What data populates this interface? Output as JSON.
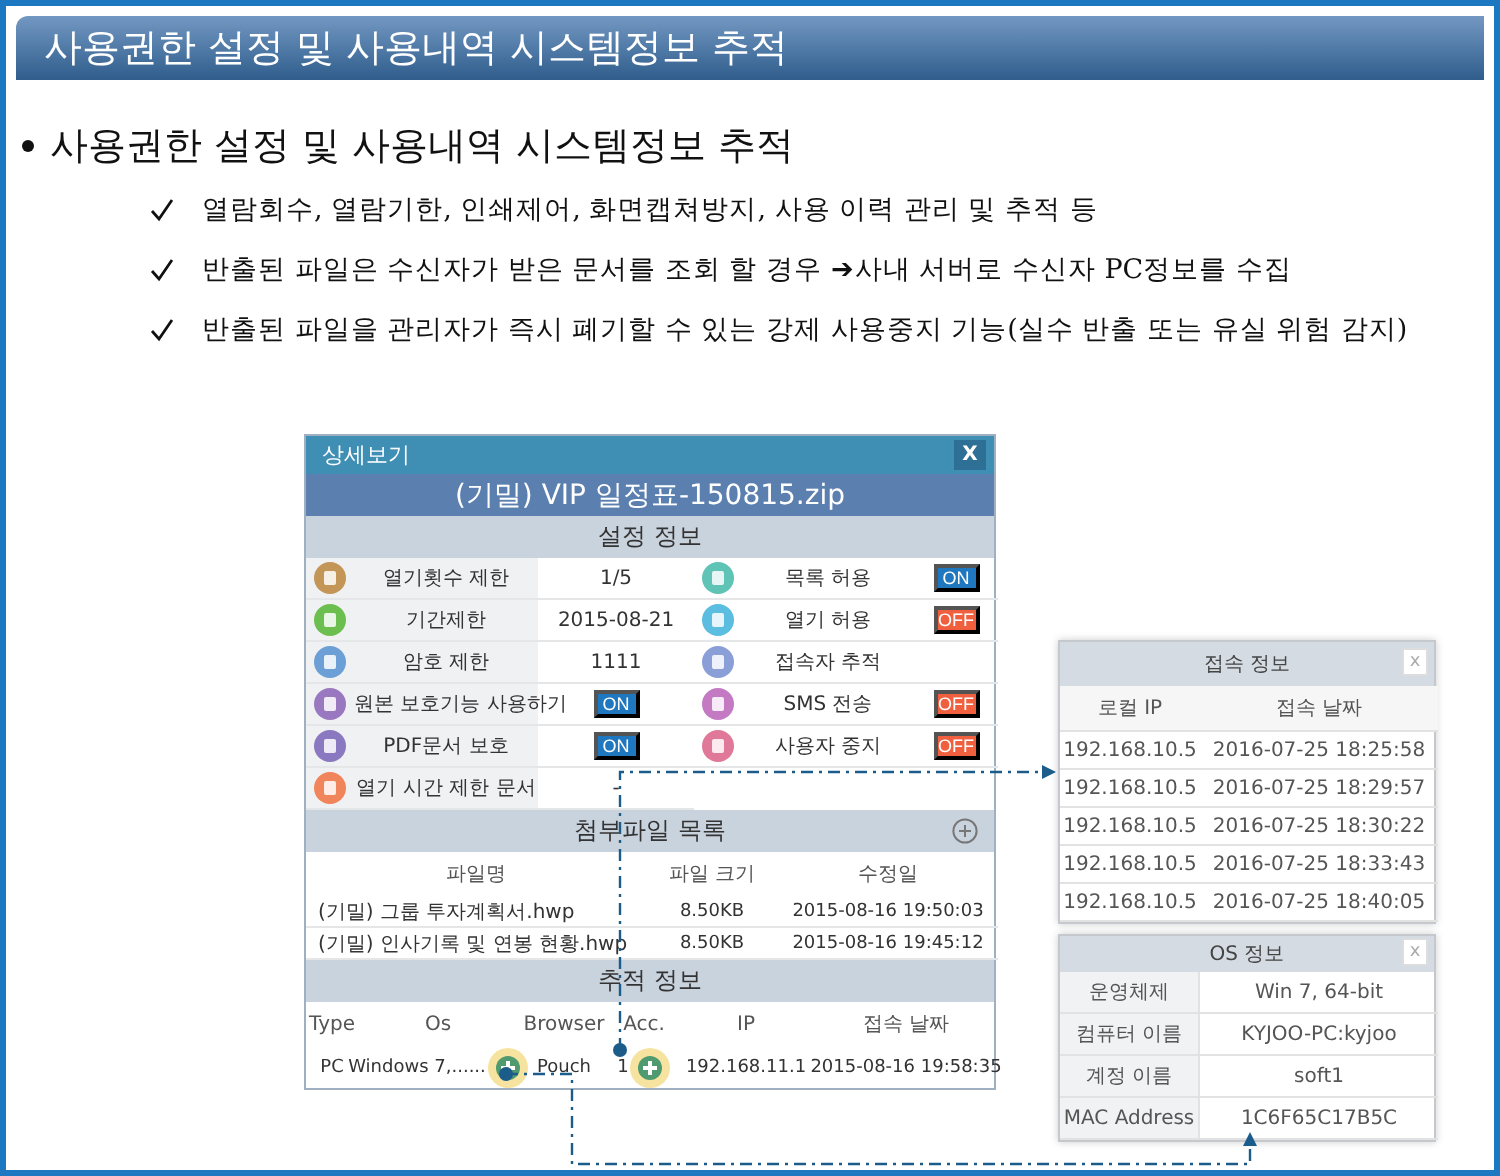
{
  "slide_title": "사용권한 설정 및 사용내역 시스템정보 추적",
  "heading": "사용권한 설정 및 사용내역 시스템정보 추적",
  "bullets": [
    "열람회수, 열람기한, 인쇄제어, 화면캡쳐방지, 사용 이력 관리 및 추적 등",
    "반출된 파일은 수신자가 받은 문서를 조회 할 경우 ➔사내 서버로 수신자 PC정보를 수집",
    "반출된 파일을 관리자가 즉시 폐기할 수 있는 강제 사용중지 기능(실수 반출 또는 유실 위험 감지)"
  ],
  "detail_window": {
    "title": "상세보기",
    "close": "X",
    "file_name": "(기밀) VIP 일정표-150815.zip",
    "settings_header": "설정 정보",
    "settings": [
      {
        "kind": "text",
        "label": "열기횟수 제한",
        "color": "#c39556",
        "value": "1/5"
      },
      {
        "kind": "switch",
        "label": "목록 허용",
        "color": "#5fc3b5",
        "value": "ON",
        "on": true
      },
      {
        "kind": "text",
        "label": "기간제한",
        "color": "#6cbf4f",
        "value": "2015-08-21"
      },
      {
        "kind": "switch",
        "label": "열기 허용",
        "color": "#5bbde0",
        "value": "OFF",
        "on": false
      },
      {
        "kind": "text",
        "label": "암호 제한",
        "color": "#6c9fd6",
        "value": "1111"
      },
      {
        "kind": "none",
        "label": "접속자 추적",
        "color": "#8a9fd8"
      },
      {
        "kind": "switch",
        "label": "원본 보호기능 사용하기",
        "color": "#9a78c0",
        "value": "ON",
        "on": true
      },
      {
        "kind": "switch",
        "label": "SMS 전송",
        "color": "#c47ac2",
        "value": "OFF",
        "on": false
      },
      {
        "kind": "switch",
        "label": "PDF문서 보호",
        "color": "#8a78c0",
        "value": "ON",
        "on": true
      },
      {
        "kind": "switch",
        "label": "사용자 중지",
        "color": "#e0789a",
        "value": "OFF",
        "on": false
      },
      {
        "kind": "text",
        "label": "열기 시간 제한 문서",
        "color": "#f0845a",
        "value": "-"
      }
    ],
    "attach_header": "첨부파일 목록",
    "attach_columns": [
      "파일명",
      "파일 크기",
      "수정일"
    ],
    "attach_rows": [
      [
        "(기밀) 그룹 투자계획서.hwp",
        "8.50KB",
        "2015-08-16 19:50:03"
      ],
      [
        "(기밀) 인사기록 및 연봉 현황.hwp",
        "8.50KB",
        "2015-08-16 19:45:12"
      ]
    ],
    "track_header": "추적 정보",
    "track_columns": [
      "Type",
      "Os",
      "Browser",
      "Acc.",
      "IP",
      "접속 날짜"
    ],
    "track_row": [
      {
        "text": "PC",
        "plus": false
      },
      {
        "text": "Windows 7,......",
        "plus": true
      },
      {
        "text": "Pouch",
        "plus": false
      },
      {
        "text": "1",
        "plus": true
      },
      {
        "text": "192.168.11.1",
        "plus": false
      },
      {
        "text": "2015-08-16 19:58:35",
        "plus": false
      }
    ]
  },
  "access_popup": {
    "title": "접속 정보",
    "close": "x",
    "columns": [
      "로컬 IP",
      "접속 날짜"
    ],
    "rows": [
      [
        "192.168.10.5",
        "2016-07-25 18:25:58"
      ],
      [
        "192.168.10.5",
        "2016-07-25 18:29:57"
      ],
      [
        "192.168.10.5",
        "2016-07-25 18:30:22"
      ],
      [
        "192.168.10.5",
        "2016-07-25 18:33:43"
      ],
      [
        "192.168.10.5",
        "2016-07-25 18:40:05"
      ]
    ]
  },
  "os_popup": {
    "title": "OS 정보",
    "close": "x",
    "rows": [
      {
        "label": "운영체제",
        "value": "Win 7, 64-bit"
      },
      {
        "label": "컴퓨터 이름",
        "value": "KYJOO-PC:kyjoo"
      },
      {
        "label": "계정 이름",
        "value": "soft1"
      },
      {
        "label": "MAC Address",
        "value": "1C6F65C17B5C"
      }
    ]
  }
}
